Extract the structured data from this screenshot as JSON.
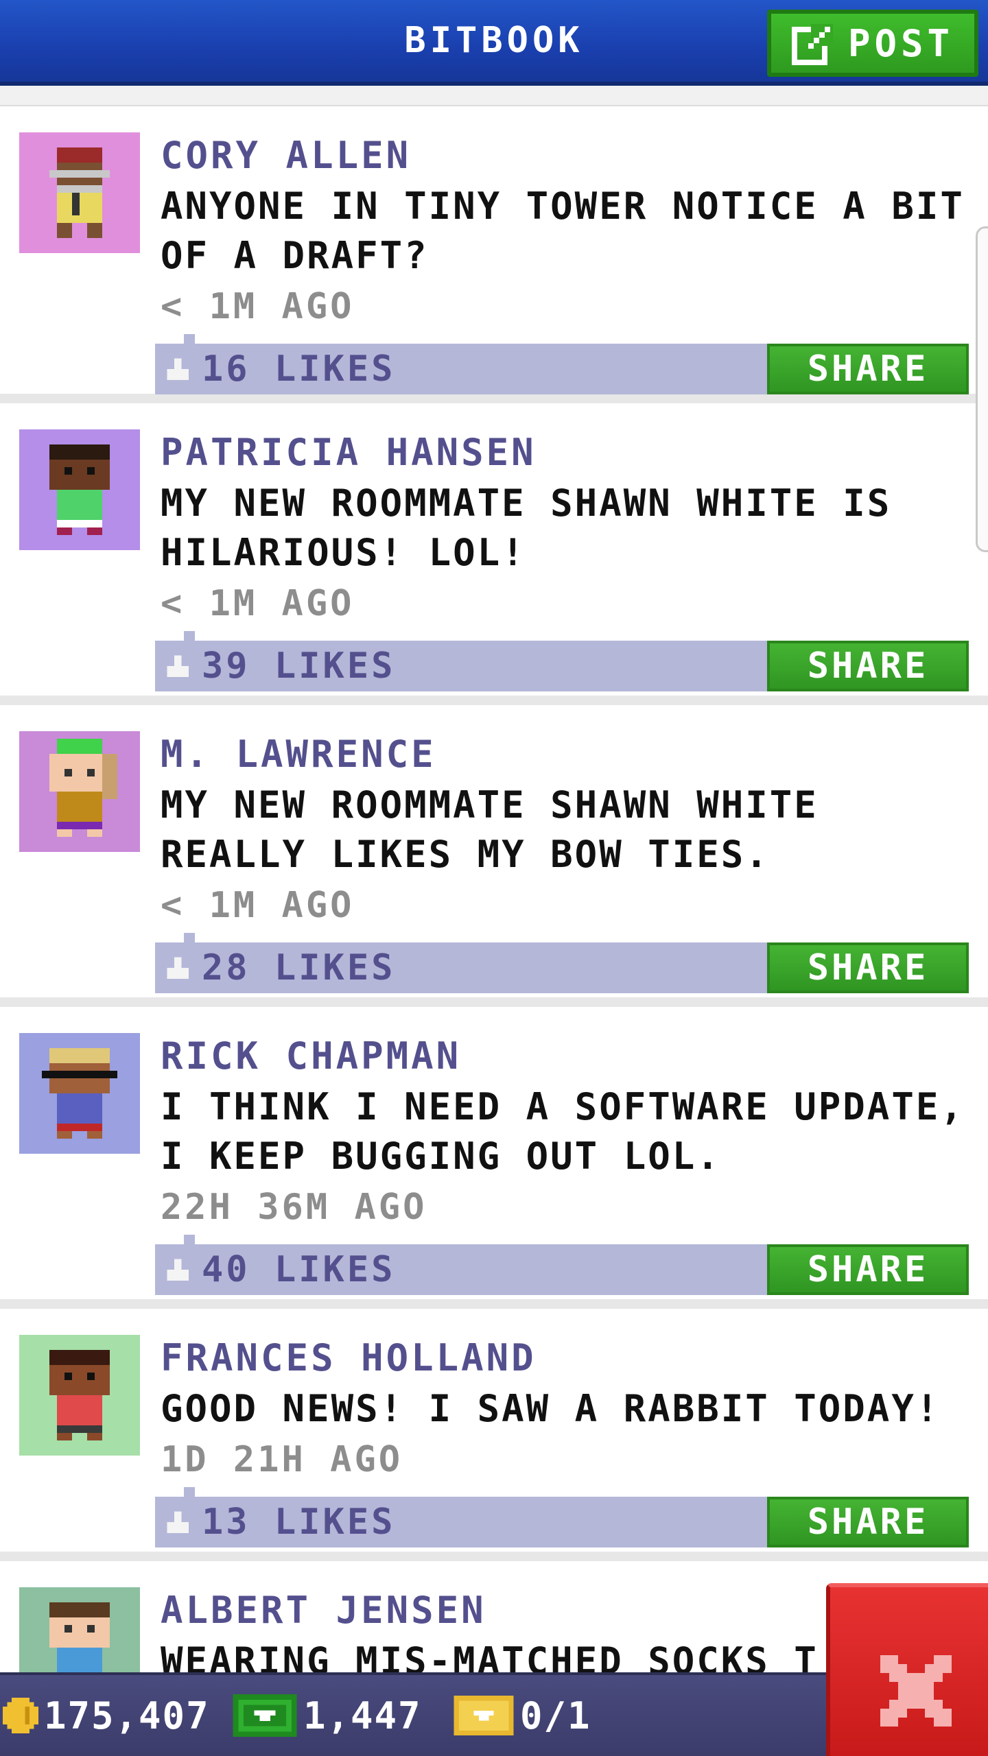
{
  "header": {
    "title": "BITBOOK",
    "post_label": "POST"
  },
  "colors": {
    "header_blue": "#1a3fae",
    "action_green": "#3aa62a",
    "likes_bar": "#b4b7d8",
    "author_purple": "#54508e",
    "status_bar": "#44457a",
    "close_red": "#d92424"
  },
  "posts": [
    {
      "author": "CORY ALLEN",
      "message": "ANYONE IN TINY TOWER NOTICE A BIT OF A DRAFT?",
      "time": "< 1M AGO",
      "likes": "16 LIKES",
      "share_label": "SHARE",
      "avatar_bg": "#e08fdc"
    },
    {
      "author": "PATRICIA HANSEN",
      "message": "MY NEW ROOMMATE SHAWN WHITE IS HILARIOUS! LOL!",
      "time": "< 1M AGO",
      "likes": "39 LIKES",
      "share_label": "SHARE",
      "avatar_bg": "#b48ee8"
    },
    {
      "author": "M. LAWRENCE",
      "message": "MY NEW ROOMMATE SHAWN WHITE REALLY LIKES MY BOW TIES.",
      "time": "< 1M AGO",
      "likes": "28 LIKES",
      "share_label": "SHARE",
      "avatar_bg": "#c98ad8"
    },
    {
      "author": "RICK CHAPMAN",
      "message": "I THINK I NEED A SOFTWARE UPDATE, I KEEP BUGGING OUT LOL.",
      "time": "22H 36M AGO",
      "likes": "40 LIKES",
      "share_label": "SHARE",
      "avatar_bg": "#9aa0e0"
    },
    {
      "author": "FRANCES HOLLAND",
      "message": "GOOD NEWS! I SAW A RABBIT TODAY!",
      "time": "1D 21H AGO",
      "likes": "13 LIKES",
      "share_label": "SHARE",
      "avatar_bg": "#a6dfa8"
    },
    {
      "author": "ALBERT JENSEN",
      "message": "WEARING MIS-MATCHED SOCKS T",
      "avatar_bg": "#8cc0a0"
    }
  ],
  "status": {
    "coins": "175,407",
    "bux": "1,447",
    "tickets": "0/1"
  },
  "icons": {
    "post": "edit-icon",
    "like": "thumbs-up-icon",
    "coin": "coin-icon",
    "bux": "bux-icon",
    "ticket": "ticket-icon",
    "close": "close-icon"
  }
}
